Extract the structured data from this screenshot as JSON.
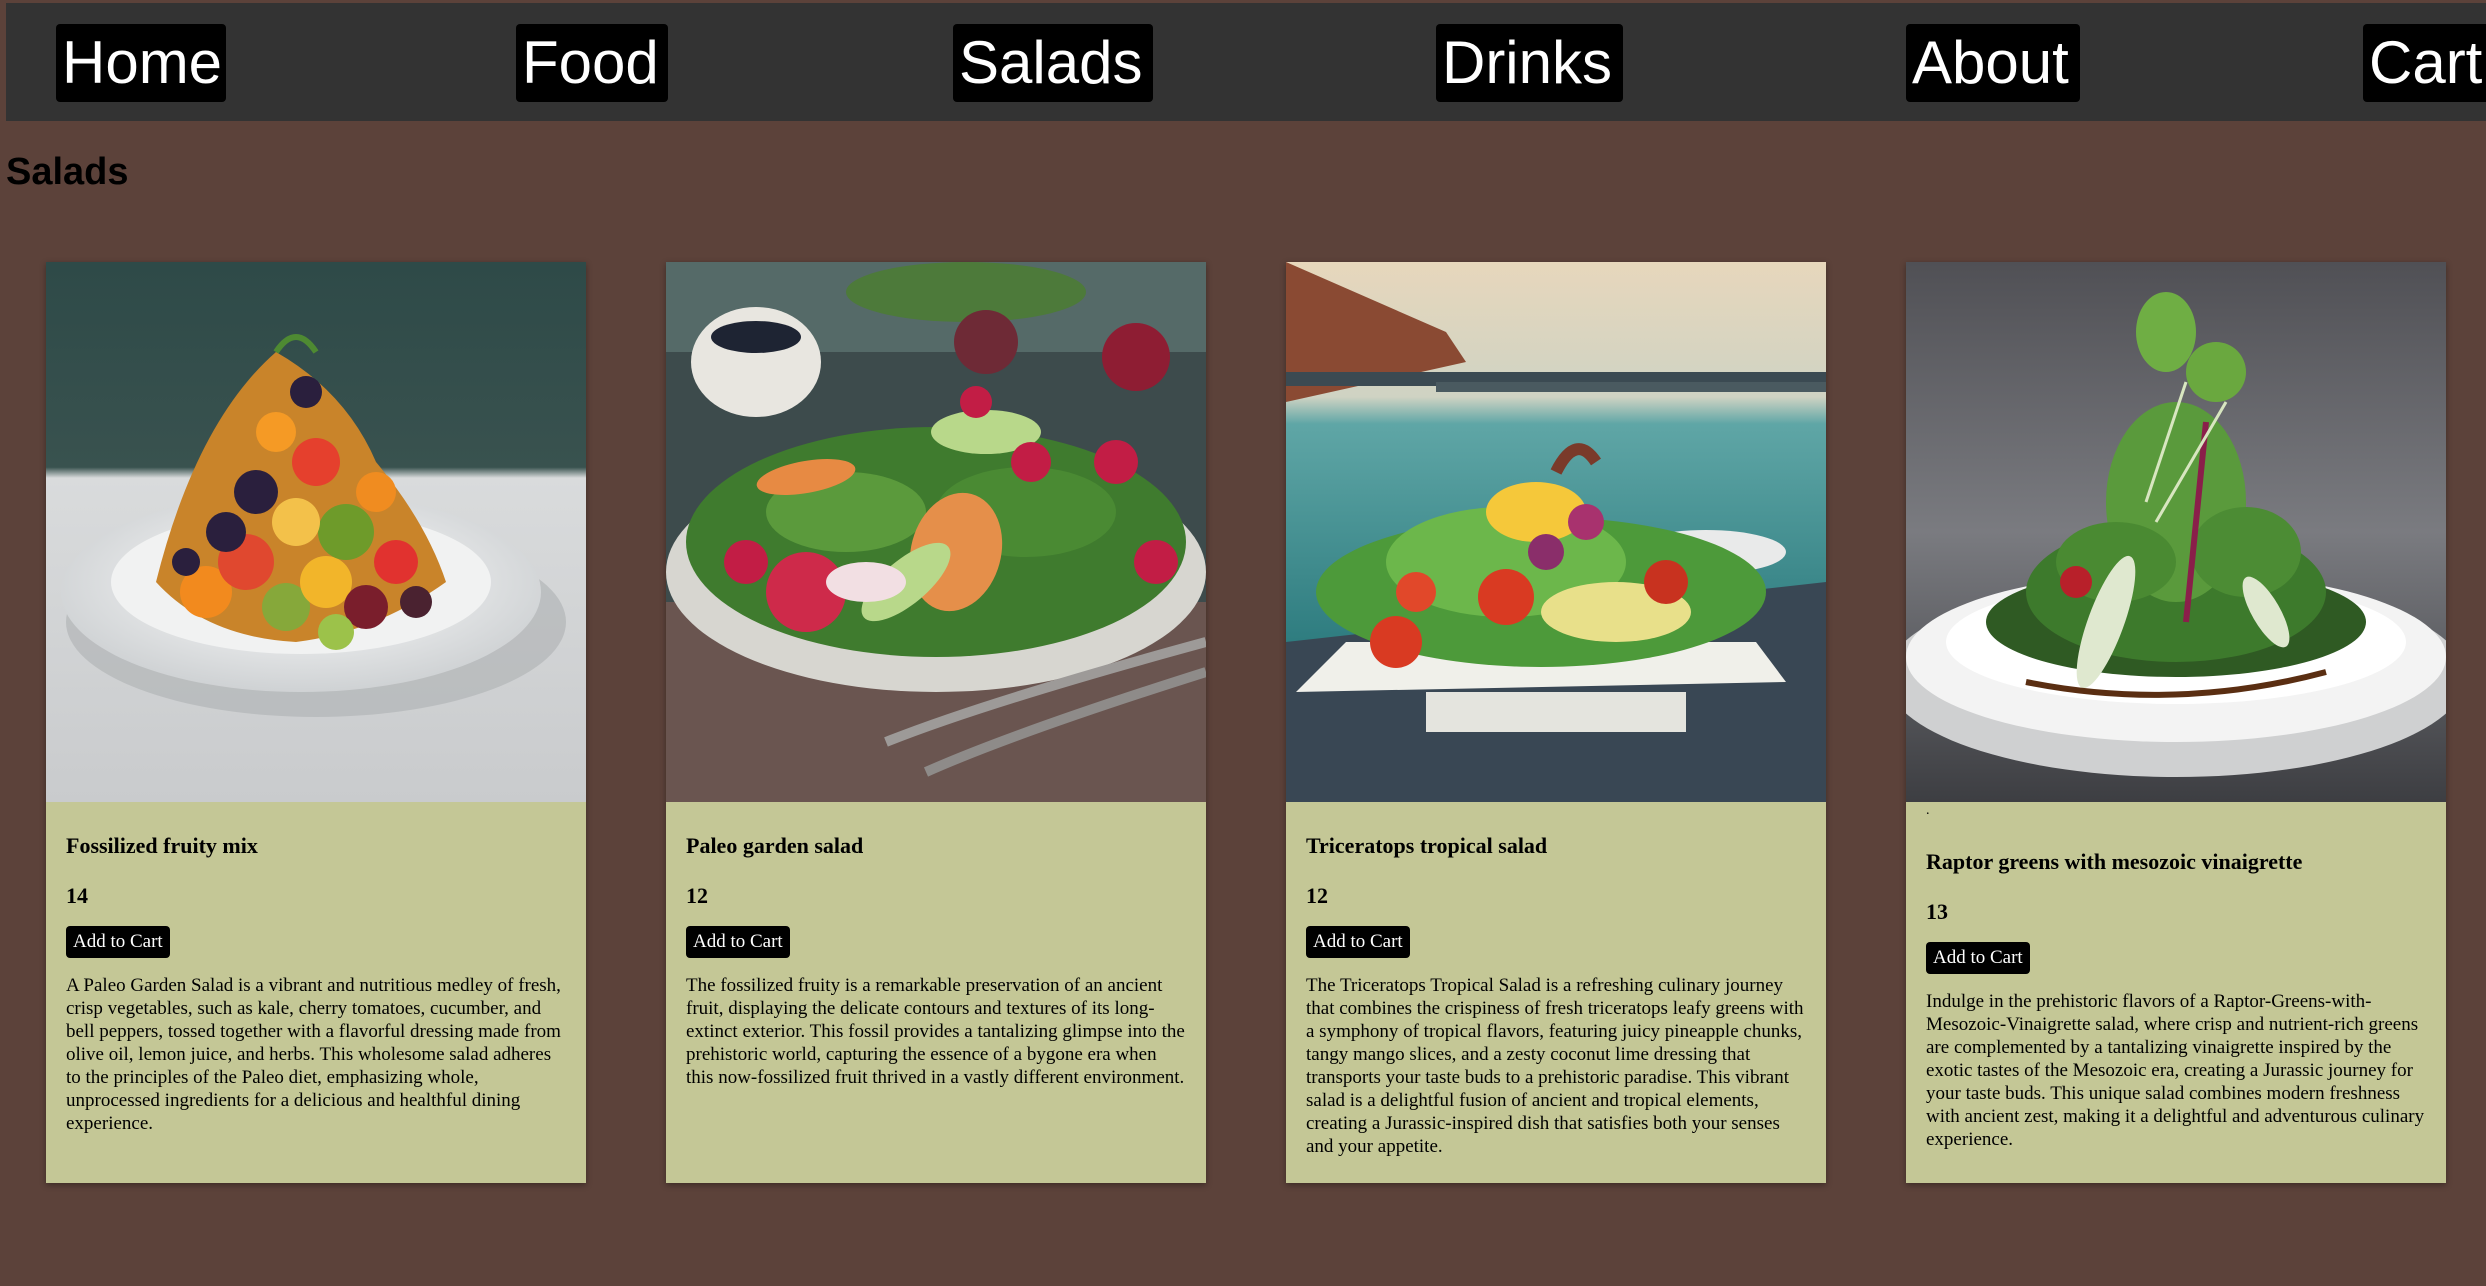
{
  "nav": {
    "home": "Home",
    "food": "Food",
    "salads": "Salads",
    "drinks": "Drinks",
    "about": "About",
    "cart": "Cart"
  },
  "page": {
    "title": "Salads"
  },
  "products": [
    {
      "name": "Fossilized fruity mix",
      "price": "14",
      "button": "Add to Cart",
      "description": "A Paleo Garden Salad is a vibrant and nutritious medley of fresh, crisp vegetables, such as kale, cherry tomatoes, cucumber, and bell peppers, tossed together with a flavorful dressing made from olive oil, lemon juice, and herbs. This wholesome salad adheres to the principles of the Paleo diet, emphasizing whole, unprocessed ingredients for a delicious and healthful dining experience."
    },
    {
      "name": "Paleo garden salad",
      "price": "12",
      "button": "Add to Cart",
      "description": "The fossilized fruity is a remarkable preservation of an ancient fruit, displaying the delicate contours and textures of its long-extinct exterior. This fossil provides a tantalizing glimpse into the prehistoric world, capturing the essence of a bygone era when this now-fossilized fruit thrived in a vastly different environment."
    },
    {
      "name": "Triceratops tropical salad",
      "price": "12",
      "button": "Add to Cart",
      "description": "The Triceratops Tropical Salad is a refreshing culinary journey that combines the crispiness of fresh triceratops leafy greens with a symphony of tropical flavors, featuring juicy pineapple chunks, tangy mango slices, and a zesty coconut lime dressing that transports your taste buds to a prehistoric paradise. This vibrant salad is a delightful fusion of ancient and tropical elements, creating a Jurassic-inspired dish that satisfies both your senses and your appetite."
    },
    {
      "name": "Raptor greens with mesozoic vinaigrette",
      "price": "13",
      "button": "Add to Cart",
      "leading_mark": ".",
      "description": "Indulge in the prehistoric flavors of a Raptor-Greens-with-Mesozoic-Vinaigrette salad, where crisp and nutrient-rich greens are complemented by a tantalizing vinaigrette inspired by the exotic tastes of the Mesozoic era, creating a Jurassic journey for your taste buds. This unique salad combines modern freshness with ancient zest, making it a delightful and adventurous culinary experience."
    }
  ],
  "colors": {
    "page_background": "#5c423a",
    "navbar_background": "#333333",
    "nav_button_background": "#000000",
    "card_background": "#c4c796"
  }
}
